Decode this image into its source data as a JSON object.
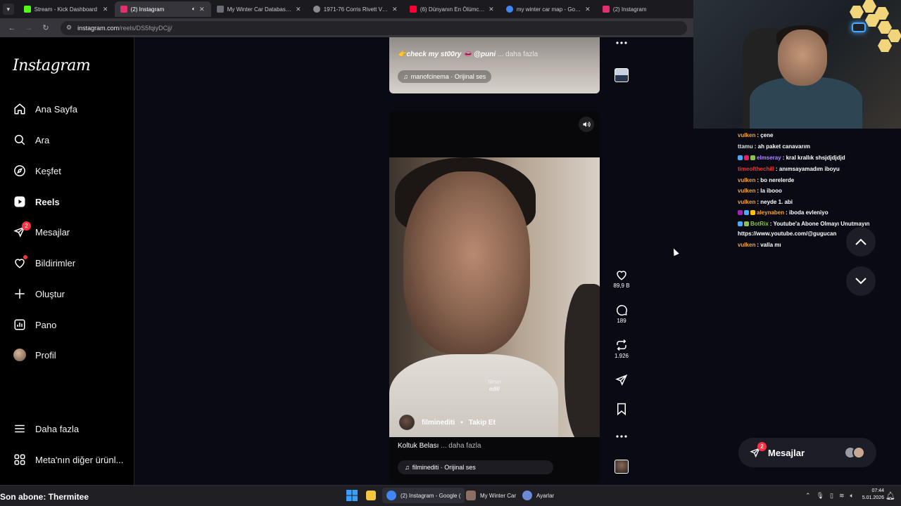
{
  "browser": {
    "tabs": [
      {
        "title": "Stream - Kick Dashboard",
        "favicon_color": "#53fc18",
        "active": false
      },
      {
        "title": "(2) Instagram",
        "favicon_color": "#e1306c",
        "active": true
      },
      {
        "title": "My Winter Car Database | S",
        "favicon_color": "#6b6b75",
        "active": false
      },
      {
        "title": "1971-76 Corris Rivett VINPL",
        "favicon_color": "#8a8a90",
        "active": false
      },
      {
        "title": "(6) Dünyanın En Ölümcül Ku",
        "favicon_color": "#ff0033",
        "active": false
      },
      {
        "title": "my winter car map - Google",
        "favicon_color": "#4285f4",
        "active": false
      },
      {
        "title": "(2) Instagram",
        "favicon_color": "#e1306c",
        "active": false
      }
    ],
    "url_host": "instagram.com",
    "url_path": "/reels/DS5fqiyDCjj/"
  },
  "sidebar": {
    "logo": "Instagram",
    "items": [
      {
        "label": "Ana Sayfa"
      },
      {
        "label": "Ara"
      },
      {
        "label": "Keşfet"
      },
      {
        "label": "Reels"
      },
      {
        "label": "Mesajlar",
        "badge": "2"
      },
      {
        "label": "Bildirimler"
      },
      {
        "label": "Oluştur"
      },
      {
        "label": "Pano"
      },
      {
        "label": "Profil"
      }
    ],
    "more": "Daha fazla",
    "meta": "Meta'nın diğer ürünl..."
  },
  "prev_reel": {
    "caption": "👉check my st00ry 👄 @puni",
    "more": "... daha fazla",
    "audio": "manofcinema · Orijinal ses"
  },
  "reel": {
    "watermark_top": "filmin",
    "watermark_bottom": "editi",
    "author": "filmineditі",
    "follow": "Takip Et",
    "caption": "Koltuk Belası",
    "more": "... daha fazla",
    "audio": "filmineditі · Orijinal ses",
    "likes": "89,9 B",
    "comments": "189",
    "reposts": "1.926"
  },
  "chat": [
    {
      "user": "vulken",
      "color": "#f5a623",
      "text": ": çene"
    },
    {
      "user": "ttamu",
      "color": "#dddddd",
      "text": ": ah paket canavarım"
    },
    {
      "user": "elmseray",
      "color": "#b388ff",
      "text": ": kral krallık shsjdjdjdjd",
      "badges": [
        "#4aa8ff",
        "#e91e63",
        "#8bc34a"
      ]
    },
    {
      "user": "timeofthechill",
      "color": "#e53935",
      "text": ": anımsayamadım iboyu"
    },
    {
      "user": "vulken",
      "color": "#f5a623",
      "text": ": bo nerelerde"
    },
    {
      "user": "vulken",
      "color": "#f5a623",
      "text": ": la ibooo"
    },
    {
      "user": "vulken",
      "color": "#f5a623",
      "text": ": neyde 1. abi"
    },
    {
      "user": "aleynaben",
      "color": "#f5a623",
      "text": ": iboda evleniyo",
      "badges": [
        "#9c27b0",
        "#4aa8ff",
        "#ffc107"
      ]
    },
    {
      "user": "BotRix",
      "color": "#8bc34a",
      "text": ": Youtube'a Abone Olmayı Unutmayın",
      "badges": [
        "#4aa8ff",
        "#8bc34a"
      ]
    },
    {
      "user": "",
      "color": "#ffffff",
      "text": "https://www.youtube.com/@gugucan"
    },
    {
      "user": "vulken",
      "color": "#f5a623",
      "text": ": valla mı"
    }
  ],
  "messages_pill": {
    "label": "Mesajlar",
    "badge": "2"
  },
  "overlay": {
    "last_sub": "Son abone: Thermitee"
  },
  "taskbar": {
    "items": [
      {
        "label": "(2) Instagram - Google (",
        "color": "#4285f4"
      },
      {
        "label": "My Winter Car",
        "color": "#8d6e63"
      },
      {
        "label": "Ayarlar",
        "color": "#6b8bd6"
      }
    ],
    "time": "07:44",
    "date": "5.01.2026"
  }
}
